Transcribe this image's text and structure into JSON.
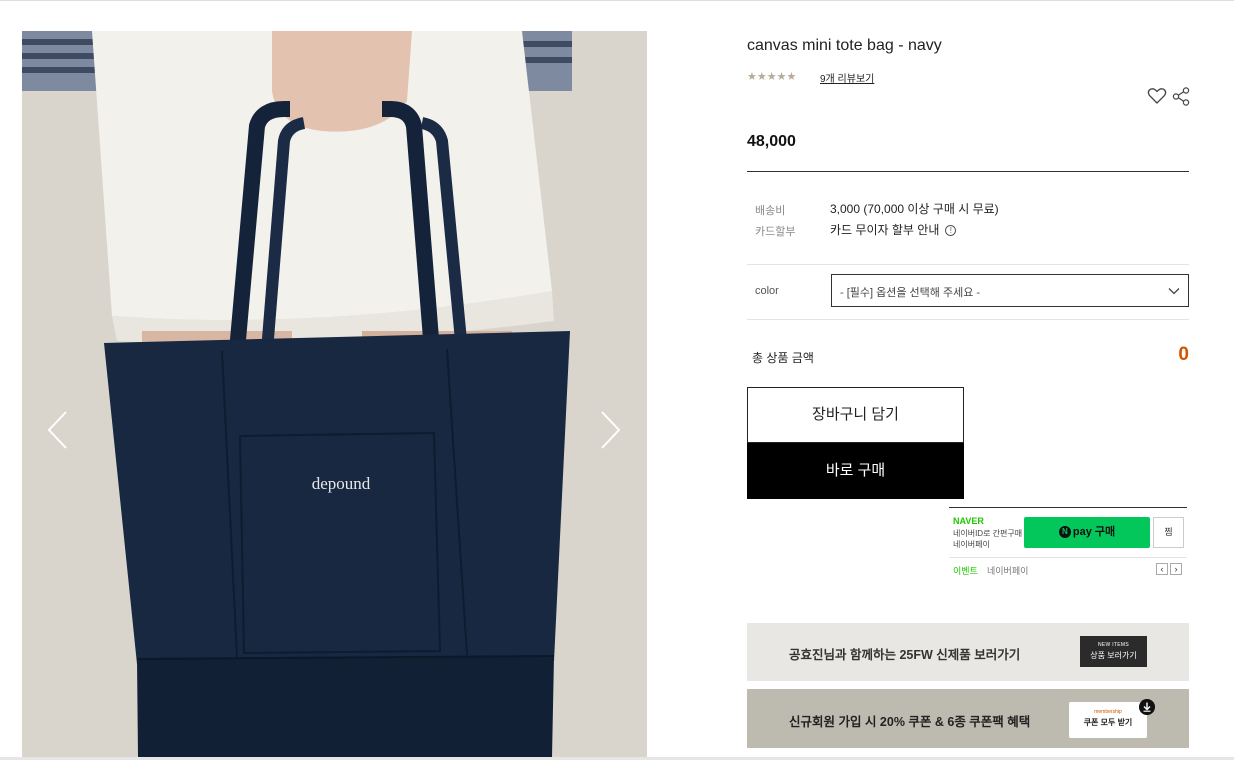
{
  "product": {
    "title": "canvas mini tote bag - navy",
    "stars": "★★★★★",
    "rating": 5,
    "review_link": "9개 리뷰보기",
    "price": "48,000",
    "photo_brand": "depound"
  },
  "details": {
    "shipping_label": "배송비",
    "shipping_value": "3,000 (70,000 이상 구매 시 무료)",
    "installment_label": "카드할부",
    "installment_value": "카드 무이자 할부 안내",
    "info_glyph": "!"
  },
  "option": {
    "label": "color",
    "placeholder": "- [필수] 옵션을 선택해 주세요 -"
  },
  "total": {
    "label": "총 상품 금액",
    "value": "0"
  },
  "buttons": {
    "cart": "장바구니 담기",
    "buy": "바로 구매"
  },
  "naverpay": {
    "brand": "NAVER",
    "line1": "네이버ID로 간편구매",
    "line2": "네이버페이",
    "pay_n": "N",
    "pay_label": "pay 구매",
    "zzim": "찜",
    "event": "이벤트",
    "event_sub": "네이버페이",
    "prev": "‹",
    "next": "›"
  },
  "banners": {
    "b1_text": "공효진님과 함께하는 25FW 신제품 보러가기",
    "b1_btn_small": "NEW ITEMS",
    "b1_btn_big": "상품 보러가기",
    "b2_text": "신규회원 가입 시 20% 쿠폰 & 6종 쿠폰팩 혜택",
    "b2_btn_small": "membership",
    "b2_btn_big": "쿠폰 모두 받기"
  },
  "colors": {
    "accent": "#d35400",
    "naver_green": "#03c75a",
    "bag_navy": "#172840"
  },
  "icons": [
    "chevron-left-icon",
    "chevron-right-icon",
    "heart-icon",
    "share-icon",
    "chevron-down-icon",
    "info-icon",
    "download-icon"
  ]
}
